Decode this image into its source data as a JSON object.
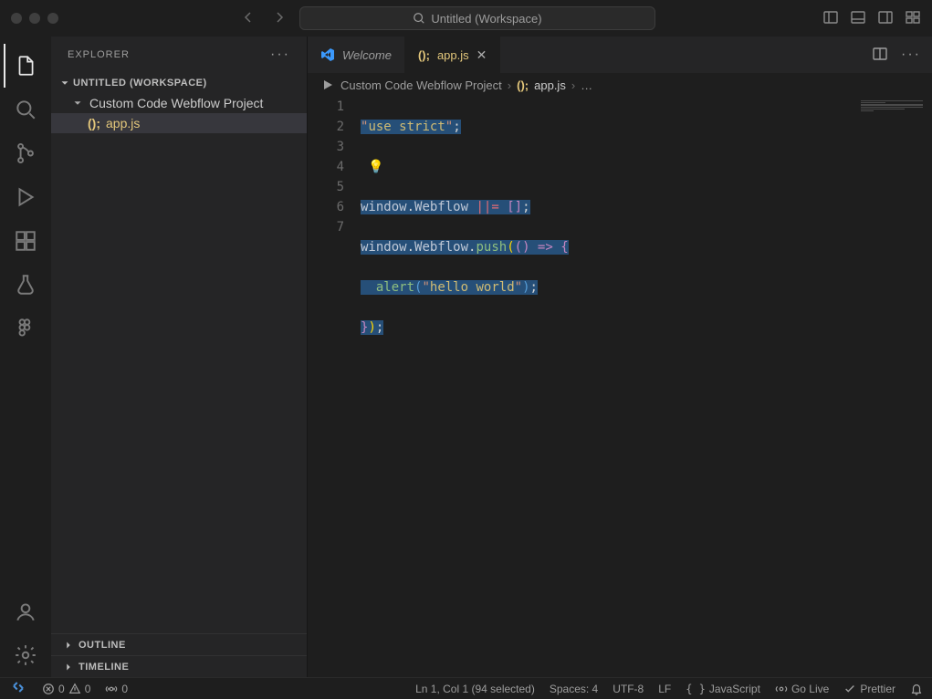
{
  "title": "Untitled (Workspace)",
  "sidebar": {
    "header": "EXPLORER",
    "workspace_label": "UNTITLED (WORKSPACE)",
    "folder_name": "Custom Code Webflow Project",
    "file_prefix": "();",
    "file_name": "app.js",
    "outline_label": "OUTLINE",
    "timeline_label": "TIMELINE"
  },
  "tabs": {
    "welcome": "Welcome",
    "app_prefix": "();",
    "app_name": "app.js"
  },
  "breadcrumb": {
    "folder": "Custom Code Webflow Project",
    "file_prefix": "();",
    "file": "app.js",
    "more": "…"
  },
  "code": {
    "lines": [
      "1",
      "2",
      "3",
      "4",
      "5",
      "6",
      "7"
    ],
    "l1_a": "\"",
    "l1_b": "use",
    "l1_sp": " ",
    "l1_c": "strict",
    "l1_d": "\"",
    "l1_e": ";",
    "l2_bulb": "💡",
    "l3_a": "window",
    "l3_b": ".",
    "l3_c": "Webflow",
    "l3_d": " ||= ",
    "l3_e": "[",
    "l3_f": "]",
    "l3_g": ";",
    "l4_a": "window",
    "l4_b": ".",
    "l4_c": "Webflow",
    "l4_d": ".",
    "l4_e": "push",
    "l4_f": "(",
    "l4_g": "(",
    "l4_h": ")",
    "l4_i": " => ",
    "l4_j": "{",
    "l5_pad": "  ",
    "l5_a": "alert",
    "l5_b": "(",
    "l5_c": "\"",
    "l5_d": "hello",
    "l5_sp": " ",
    "l5_e": "world",
    "l5_f": "\"",
    "l5_g": ")",
    "l5_h": ";",
    "l6_a": "}",
    "l6_b": ")",
    "l6_c": ";"
  },
  "status": {
    "errors": "0",
    "warnings": "0",
    "ports": "0",
    "cursor": "Ln 1, Col 1 (94 selected)",
    "spaces": "Spaces: 4",
    "encoding": "UTF-8",
    "eol": "LF",
    "lang": "JavaScript",
    "go_live": "Go Live",
    "prettier": "Prettier"
  }
}
